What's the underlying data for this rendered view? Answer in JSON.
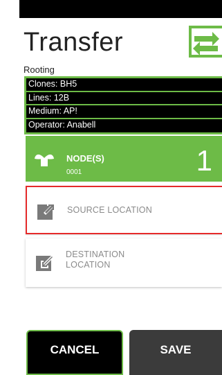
{
  "header": {
    "title": "Transfer",
    "subtitle": "Rooting"
  },
  "info": {
    "clones": "Clones: BH5",
    "lines": "Lines: 12B",
    "medium": "Medium: AP!",
    "operator": "Operator: Anabell"
  },
  "node": {
    "label": "NODE(S)",
    "id": "0001",
    "count": "1"
  },
  "source": {
    "label": "SOURCE LOCATION"
  },
  "destination": {
    "line1": "DESTINATION",
    "line2": "LOCATION"
  },
  "actions": {
    "cancel_label": "CANCEL",
    "save_label": "SAVE"
  },
  "colors": {
    "accent": "#6dbb47",
    "error_border": "#e52a2a",
    "save_button": "#3b3b3b"
  },
  "icons": {
    "header": "transfer-arrows-icon",
    "node": "plant-sprout-icon",
    "source": "export-arrow-icon",
    "destination": "import-arrow-icon"
  }
}
